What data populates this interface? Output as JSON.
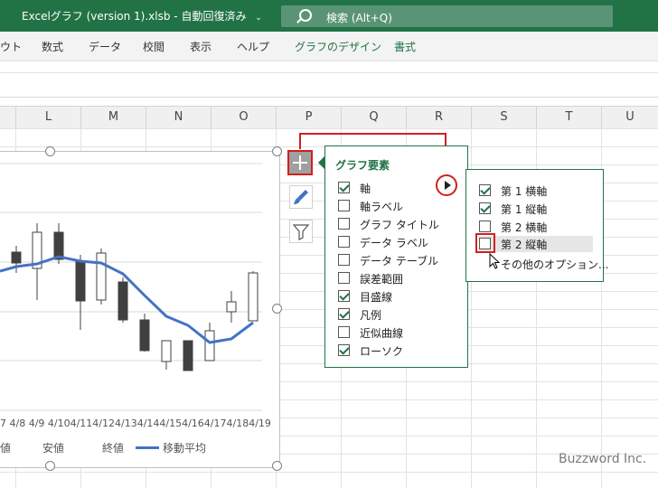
{
  "title_bar": {
    "title": "Excelグラフ (version 1).xlsb  -  自動回復済み",
    "dropdown_arrow": "⌄",
    "search_placeholder": "検索 (Alt+Q)"
  },
  "ribbon_tabs": [
    "ウト",
    "数式",
    "データ",
    "校閲",
    "表示",
    "ヘルプ",
    "グラフのデザイン",
    "書式"
  ],
  "columns": [
    "L",
    "M",
    "N",
    "O",
    "P",
    "Q",
    "R",
    "S",
    "T",
    "U"
  ],
  "chart": {
    "type": "candlestick",
    "x_labels": [
      "7",
      "4/8",
      "4/9",
      "4/10",
      "4/11",
      "4/12",
      "4/13",
      "4/14",
      "4/15",
      "4/16",
      "4/17",
      "4/18",
      "4/19"
    ],
    "x_labels_text": "7  4/8  4/9  4/104/114/124/134/144/154/164/174/184/19",
    "legend": [
      "値",
      "安値",
      "終値",
      "移動平均"
    ],
    "moving_average_color": "#4472c4"
  },
  "chart_elements_panel": {
    "title": "グラフ要素",
    "items": [
      {
        "label": "軸",
        "checked": true
      },
      {
        "label": "軸ラベル",
        "checked": false
      },
      {
        "label": "グラフ タイトル",
        "checked": false
      },
      {
        "label": "データ ラベル",
        "checked": false
      },
      {
        "label": "データ テーブル",
        "checked": false
      },
      {
        "label": "誤差範囲",
        "checked": false
      },
      {
        "label": "目盛線",
        "checked": true
      },
      {
        "label": "凡例",
        "checked": true
      },
      {
        "label": "近似曲線",
        "checked": false
      },
      {
        "label": "ローソク",
        "checked": true
      }
    ]
  },
  "axes_submenu": {
    "items": [
      {
        "label": "第 1 横軸",
        "checked": true
      },
      {
        "label": "第 1 縦軸",
        "checked": true
      },
      {
        "label": "第 2 横軸",
        "checked": false
      },
      {
        "label": "第 2 縦軸",
        "checked": false
      }
    ],
    "more_options": "その他のオプション..."
  },
  "watermark": "Buzzword Inc."
}
